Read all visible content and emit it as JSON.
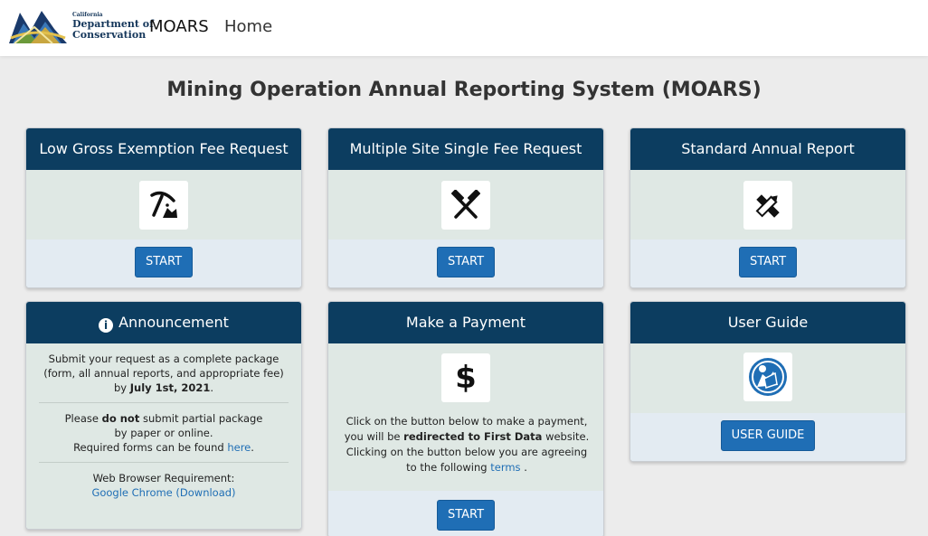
{
  "nav": {
    "logo": {
      "small": "California",
      "line1": "Department of",
      "line2": "Conservation"
    },
    "brand": "MOARS",
    "home": "Home"
  },
  "page_title": "Mining Operation Annual Reporting System (MOARS)",
  "cards": {
    "low_gross": {
      "title": "Low Gross Exemption Fee Request",
      "icon": "pickaxe-icon",
      "button": "START"
    },
    "multiple_site": {
      "title": "Multiple Site Single Fee Request",
      "icon": "crossed-hammers-icon",
      "button": "START"
    },
    "standard": {
      "title": "Standard Annual Report",
      "icon": "ruler-pencil-icon",
      "button": "START"
    },
    "announcement": {
      "icon": "info-circle-icon",
      "title": "Announcement",
      "p1_a": "Submit your request as a complete package",
      "p1_b": "(form, all annual reports, and appropriate fee)",
      "p1_c": "by ",
      "p1_date": "July 1st, 2021",
      "p1_end": ".",
      "p2_a": "Please ",
      "p2_strong": "do not",
      "p2_b": " submit partial package",
      "p2_c": "by paper or online.",
      "p2_d": "Required forms can be found ",
      "p2_link": "here",
      "p2_end": ".",
      "p3_a": "Web Browser Requirement:",
      "p3_link": "Google Chrome (Download)"
    },
    "payment": {
      "title": "Make a Payment",
      "icon": "dollar-icon",
      "t1": "Click on the button below to make a payment,",
      "t2_a": "you will be ",
      "t2_strong": "redirected to First Data",
      "t2_b": " website.",
      "t3": "Clicking on the button below you are agreeing",
      "t4_a": "to the following ",
      "t4_link": "terms",
      "t4_end": " .",
      "button": "START"
    },
    "user_guide": {
      "title": "User Guide",
      "icon": "user-guide-icon",
      "button": "USER GUIDE"
    }
  },
  "colors": {
    "header": "#0c3d60",
    "button": "#1f6eb5",
    "body": "#dfe8e4",
    "footer": "#e3ebf2",
    "background": "#ececec"
  }
}
